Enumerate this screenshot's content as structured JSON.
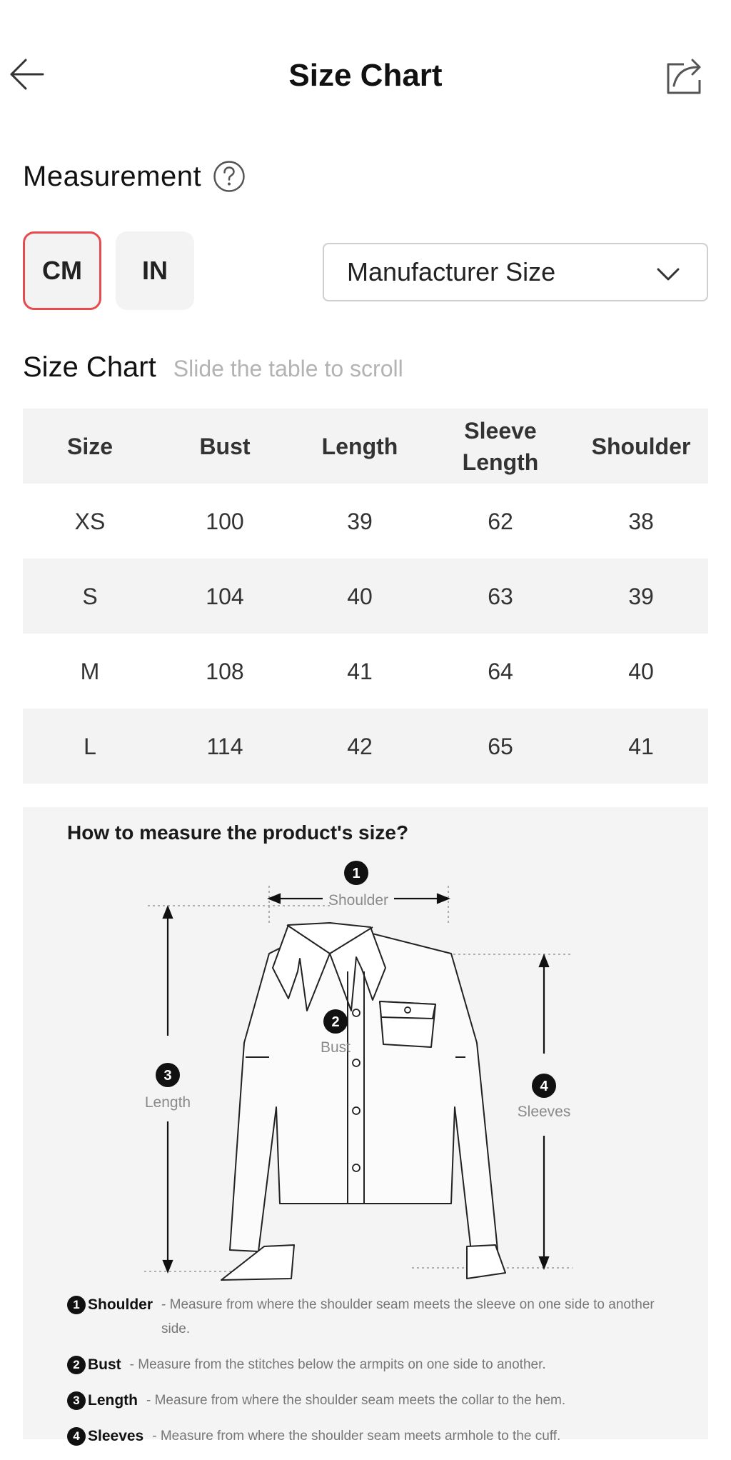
{
  "header": {
    "title": "Size Chart",
    "back_icon": "arrow-left-icon",
    "share_icon": "share-icon"
  },
  "measurement": {
    "label": "Measurement",
    "help_icon": "question-circle-icon",
    "units": [
      {
        "label": "CM",
        "selected": true
      },
      {
        "label": "IN",
        "selected": false
      }
    ],
    "accent_color": "#e64b4f",
    "size_type": {
      "value": "Manufacturer Size",
      "icon": "chevron-down-icon"
    }
  },
  "size_chart": {
    "title": "Size Chart",
    "hint": "Slide the table to scroll",
    "columns": [
      "Size",
      "Bust",
      "Length",
      "Sleeve Length",
      "Shoulder"
    ],
    "rows": [
      [
        "XS",
        "100",
        "39",
        "62",
        "38"
      ],
      [
        "S",
        "104",
        "40",
        "63",
        "39"
      ],
      [
        "M",
        "108",
        "41",
        "64",
        "40"
      ],
      [
        "L",
        "114",
        "42",
        "65",
        "41"
      ]
    ]
  },
  "guide": {
    "title": "How to measure the product's size?",
    "diagram_labels": {
      "shoulder": {
        "num": "1",
        "text": "Shoulder"
      },
      "bust": {
        "num": "2",
        "text": "Bust"
      },
      "length": {
        "num": "3",
        "text": "Length"
      },
      "sleeves": {
        "num": "4",
        "text": "Sleeves"
      }
    },
    "legend": [
      {
        "num": "1",
        "name": "Shoulder",
        "desc": "- Measure from where the shoulder seam meets the sleeve on one side to another side."
      },
      {
        "num": "2",
        "name": "Bust",
        "desc": "- Measure from the stitches below the armpits on one side to another."
      },
      {
        "num": "3",
        "name": "Length",
        "desc": "- Measure from where the shoulder seam meets the collar to the hem."
      },
      {
        "num": "4",
        "name": "Sleeves",
        "desc": "- Measure from where the shoulder seam meets armhole to the cuff."
      }
    ]
  }
}
